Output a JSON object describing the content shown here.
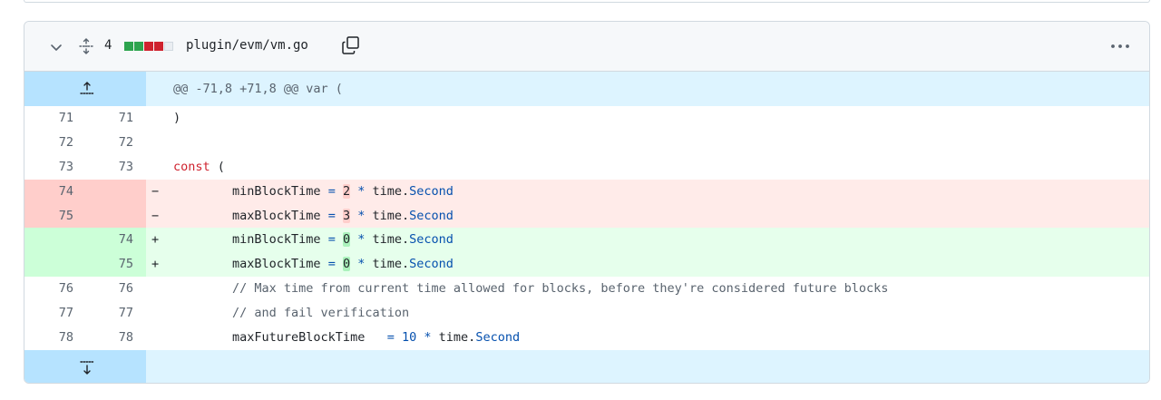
{
  "header": {
    "changes_count": "4",
    "file_path": "plugin/evm/vm.go",
    "diffstat": [
      "added",
      "added",
      "deleted",
      "deleted",
      "neutral"
    ]
  },
  "hunk": {
    "header": "@@ -71,8 +71,8 @@ var ("
  },
  "lines": [
    {
      "type": "context",
      "old": "71",
      "new": "71",
      "sign": "",
      "segments": [
        {
          "t": ")",
          "c": ""
        }
      ]
    },
    {
      "type": "context",
      "old": "72",
      "new": "72",
      "sign": "",
      "segments": []
    },
    {
      "type": "context",
      "old": "73",
      "new": "73",
      "sign": "",
      "segments": [
        {
          "t": "const",
          "c": "kw"
        },
        {
          "t": " (",
          "c": ""
        }
      ]
    },
    {
      "type": "del",
      "old": "74",
      "new": "",
      "sign": "−",
      "segments": [
        {
          "t": "        minBlockTime ",
          "c": ""
        },
        {
          "t": "=",
          "c": "op"
        },
        {
          "t": " ",
          "c": ""
        },
        {
          "t": "2",
          "c": "hl-del"
        },
        {
          "t": " ",
          "c": ""
        },
        {
          "t": "*",
          "c": "op"
        },
        {
          "t": " time.",
          "c": ""
        },
        {
          "t": "Second",
          "c": "ty"
        }
      ]
    },
    {
      "type": "del",
      "old": "75",
      "new": "",
      "sign": "−",
      "segments": [
        {
          "t": "        maxBlockTime ",
          "c": ""
        },
        {
          "t": "=",
          "c": "op"
        },
        {
          "t": " ",
          "c": ""
        },
        {
          "t": "3",
          "c": "hl-del"
        },
        {
          "t": " ",
          "c": ""
        },
        {
          "t": "*",
          "c": "op"
        },
        {
          "t": " time.",
          "c": ""
        },
        {
          "t": "Second",
          "c": "ty"
        }
      ]
    },
    {
      "type": "add",
      "old": "",
      "new": "74",
      "sign": "+",
      "segments": [
        {
          "t": "        minBlockTime ",
          "c": ""
        },
        {
          "t": "=",
          "c": "op"
        },
        {
          "t": " ",
          "c": ""
        },
        {
          "t": "0",
          "c": "hl-add"
        },
        {
          "t": " ",
          "c": ""
        },
        {
          "t": "*",
          "c": "op"
        },
        {
          "t": " time.",
          "c": ""
        },
        {
          "t": "Second",
          "c": "ty"
        }
      ]
    },
    {
      "type": "add",
      "old": "",
      "new": "75",
      "sign": "+",
      "segments": [
        {
          "t": "        maxBlockTime ",
          "c": ""
        },
        {
          "t": "=",
          "c": "op"
        },
        {
          "t": " ",
          "c": ""
        },
        {
          "t": "0",
          "c": "hl-add"
        },
        {
          "t": " ",
          "c": ""
        },
        {
          "t": "*",
          "c": "op"
        },
        {
          "t": " time.",
          "c": ""
        },
        {
          "t": "Second",
          "c": "ty"
        }
      ]
    },
    {
      "type": "context",
      "old": "76",
      "new": "76",
      "sign": "",
      "segments": [
        {
          "t": "        // Max time from current time allowed for blocks, before they're considered future blocks",
          "c": "cm"
        }
      ]
    },
    {
      "type": "context",
      "old": "77",
      "new": "77",
      "sign": "",
      "segments": [
        {
          "t": "        // and fail verification",
          "c": "cm"
        }
      ]
    },
    {
      "type": "context",
      "old": "78",
      "new": "78",
      "sign": "",
      "segments": [
        {
          "t": "        maxFutureBlockTime   ",
          "c": ""
        },
        {
          "t": "=",
          "c": "op"
        },
        {
          "t": " ",
          "c": ""
        },
        {
          "t": "10",
          "c": "num"
        },
        {
          "t": " ",
          "c": ""
        },
        {
          "t": "*",
          "c": "op"
        },
        {
          "t": " time.",
          "c": ""
        },
        {
          "t": "Second",
          "c": "ty"
        }
      ]
    }
  ],
  "colors": {
    "added": "#2da44e",
    "deleted": "#cf222e",
    "neutral": "#eaeef2"
  },
  "icons": {
    "collapse": "chevron-down-icon",
    "expand_all": "fold-icon",
    "copy": "copy-icon",
    "menu": "kebab-horizontal-icon",
    "expand_up": "fold-up-icon",
    "expand_down": "fold-down-icon"
  }
}
